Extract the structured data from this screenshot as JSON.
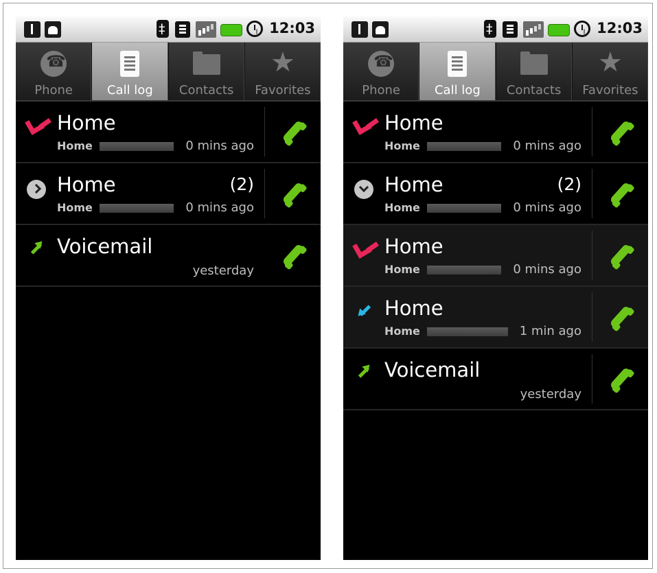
{
  "status_bar": {
    "time": "12:03"
  },
  "tabs": [
    {
      "label": "Phone",
      "icon": "phone-icon",
      "selected": false
    },
    {
      "label": "Call log",
      "icon": "call-log-icon",
      "selected": true
    },
    {
      "label": "Contacts",
      "icon": "contacts-icon",
      "selected": false
    },
    {
      "label": "Favorites",
      "icon": "star-icon",
      "selected": false
    }
  ],
  "screens": {
    "left": {
      "rows": [
        {
          "type": "missed",
          "name": "Home",
          "count": "",
          "number_type": "Home",
          "time": "0 mins ago"
        },
        {
          "type": "group-collapsed",
          "name": "Home",
          "count": "(2)",
          "number_type": "Home",
          "time": "0 mins ago"
        },
        {
          "type": "outgoing",
          "name": "Voicemail",
          "count": "",
          "number_type": "",
          "time": "yesterday"
        }
      ]
    },
    "right": {
      "rows": [
        {
          "type": "missed",
          "name": "Home",
          "count": "",
          "number_type": "Home",
          "time": "0 mins ago"
        },
        {
          "type": "group-expanded",
          "name": "Home",
          "count": "(2)",
          "number_type": "Home",
          "time": "0 mins ago"
        },
        {
          "type": "missed",
          "name": "Home",
          "count": "",
          "number_type": "Home",
          "time": "0 mins ago"
        },
        {
          "type": "incoming",
          "name": "Home",
          "count": "",
          "number_type": "Home",
          "time": "1 min ago"
        },
        {
          "type": "outgoing",
          "name": "Voicemail",
          "count": "",
          "number_type": "",
          "time": "yesterday"
        }
      ]
    }
  },
  "colors": {
    "missed": "#e8265a",
    "outgoing": "#6cc61a",
    "incoming": "#2ab7e6",
    "call_button": "#6cc61a",
    "tab_selected": "#a9a9a9"
  }
}
